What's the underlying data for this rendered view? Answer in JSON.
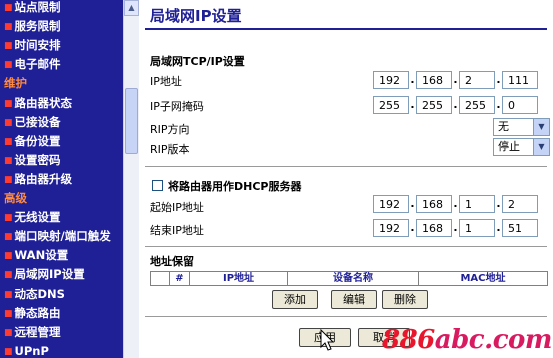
{
  "sidebar": {
    "items": [
      {
        "label": "站点限制",
        "type": "item"
      },
      {
        "label": "服务限制",
        "type": "item"
      },
      {
        "label": "时间安排",
        "type": "item"
      },
      {
        "label": "电子邮件",
        "type": "item"
      },
      {
        "label": "维护",
        "type": "section"
      },
      {
        "label": "路由器状态",
        "type": "item"
      },
      {
        "label": "已接设备",
        "type": "item"
      },
      {
        "label": "备份设置",
        "type": "item"
      },
      {
        "label": "设置密码",
        "type": "item"
      },
      {
        "label": "路由器升级",
        "type": "item"
      },
      {
        "label": "高级",
        "type": "section"
      },
      {
        "label": "无线设置",
        "type": "item"
      },
      {
        "label": "端口映射/端口触发",
        "type": "item"
      },
      {
        "label": "WAN设置",
        "type": "item"
      },
      {
        "label": "局域网IP设置",
        "type": "item"
      },
      {
        "label": "动态DNS",
        "type": "item"
      },
      {
        "label": "静态路由",
        "type": "item"
      },
      {
        "label": "远程管理",
        "type": "item"
      },
      {
        "label": "UPnP",
        "type": "item"
      }
    ]
  },
  "main": {
    "title": "局域网IP设置",
    "tcpip": {
      "section_title": "局域网TCP/IP设置",
      "ip_label": "IP地址",
      "ip": [
        "192",
        "168",
        "2",
        "111"
      ],
      "mask_label": "IP子网掩码",
      "mask": [
        "255",
        "255",
        "255",
        "0"
      ],
      "rip_direction_label": "RIP方向",
      "rip_direction_value": "无",
      "rip_version_label": "RIP版本",
      "rip_version_value": "停止"
    },
    "dhcp": {
      "checkbox_label": "将路由器用作DHCP服务器",
      "checked": false,
      "start_label": "起始IP地址",
      "start": [
        "192",
        "168",
        "1",
        "2"
      ],
      "end_label": "结束IP地址",
      "end": [
        "192",
        "168",
        "1",
        "51"
      ]
    },
    "reservation": {
      "section_title": "地址保留",
      "columns": [
        "",
        "#",
        "IP地址",
        "设备名称",
        "MAC地址"
      ],
      "add_label": "添加",
      "edit_label": "编辑",
      "delete_label": "删除"
    },
    "apply_label": "应用",
    "cancel_label": "取消"
  },
  "watermark": {
    "text": "886abc.com"
  },
  "colors": {
    "nav_bg": "#1f1f96",
    "section_text": "#ff8a3d",
    "bullet": "#ff3b30",
    "title": "#1f1f96"
  }
}
